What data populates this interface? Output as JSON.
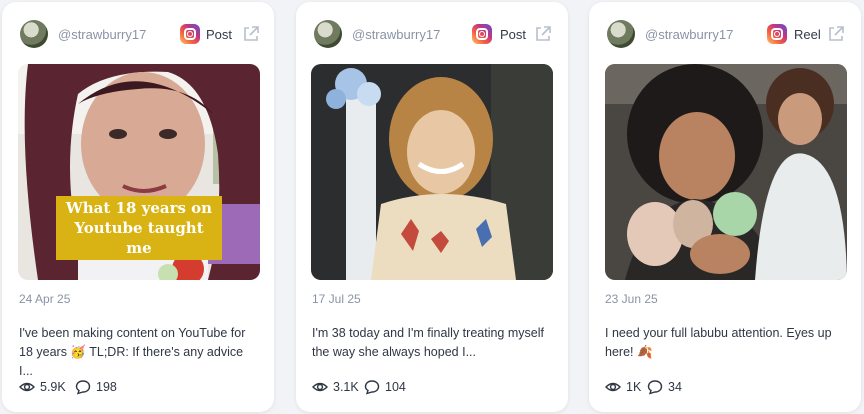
{
  "cards": [
    {
      "handle": "@strawburry17",
      "type": "Post",
      "overlay": "What 18 years on Youtube taught me",
      "date": "24 Apr 25",
      "caption": "I've been making content on YouTube for 18 years 🥳 TL;DR: If there's any advice I...",
      "views": "5.9K",
      "comments": "198"
    },
    {
      "handle": "@strawburry17",
      "type": "Post",
      "date": "17 Jul 25",
      "caption": "I'm 38 today and I'm finally treating myself the way she always hoped I...",
      "views": "3.1K",
      "comments": "104"
    },
    {
      "handle": "@strawburry17",
      "type": "Reel",
      "date": "23 Jun 25",
      "caption": "I need your full labubu attention. Eyes up here! 🍂",
      "views": "1K",
      "comments": "34"
    }
  ],
  "icons": {
    "platform": "instagram-icon",
    "external": "external-link-icon",
    "views": "eye-icon",
    "comments": "comment-icon"
  },
  "colors": {
    "background": "#f1f3f6",
    "card": "#ffffff",
    "muted_text": "#8a93a6",
    "body_text": "#2f3644",
    "overlay_bg": "#d9b213"
  }
}
